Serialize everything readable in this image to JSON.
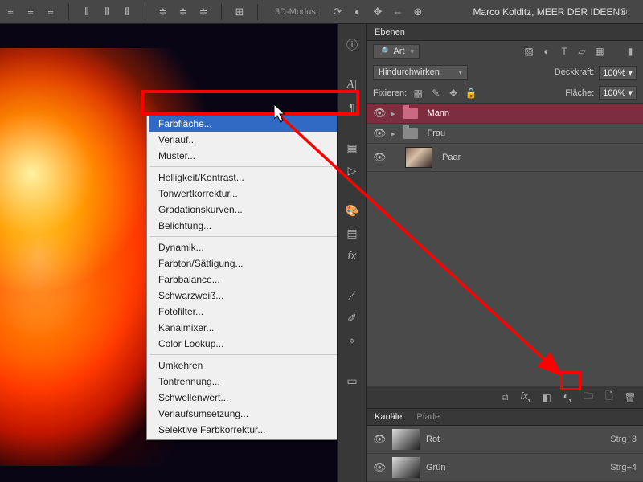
{
  "toolbar": {
    "mode3d": "3D-Modus:",
    "credit": "Marco Kolditz, MEER DER IDEEN®"
  },
  "contextMenu": {
    "groups": [
      [
        "Farbfläche...",
        "Verlauf...",
        "Muster..."
      ],
      [
        "Helligkeit/Kontrast...",
        "Tonwertkorrektur...",
        "Gradationskurven...",
        "Belichtung..."
      ],
      [
        "Dynamik...",
        "Farbton/Sättigung...",
        "Farbbalance...",
        "Schwarzweiß...",
        "Fotofilter...",
        "Kanalmixer...",
        "Color Lookup..."
      ],
      [
        "Umkehren",
        "Tontrennung...",
        "Schwellenwert...",
        "Verlaufsumsetzung...",
        "Selektive Farbkorrektur..."
      ]
    ],
    "highlighted": "Farbfläche..."
  },
  "layersPanel": {
    "title": "Ebenen",
    "filterLabel": "Art",
    "blendMode": "Hindurchwirken",
    "opacityLabel": "Deckkraft:",
    "opacityValue": "100%",
    "lockLabel": "Fixieren:",
    "fillLabel": "Fläche:",
    "fillValue": "100%",
    "layers": [
      {
        "name": "Mann",
        "type": "folder",
        "selected": true,
        "color": "pink"
      },
      {
        "name": "Frau",
        "type": "folder",
        "selected": false
      },
      {
        "name": "Paar",
        "type": "thumb",
        "selected": false
      }
    ]
  },
  "channelsPanel": {
    "tabs": [
      "Kanäle",
      "Pfade"
    ],
    "channels": [
      {
        "name": "Rot",
        "shortcut": "Strg+3"
      },
      {
        "name": "Grün",
        "shortcut": "Strg+4"
      }
    ]
  }
}
